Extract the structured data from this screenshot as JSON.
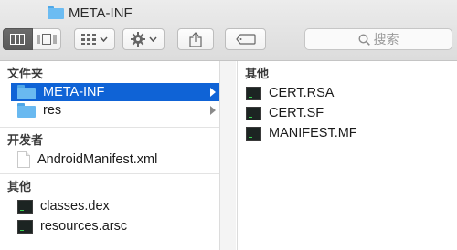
{
  "window": {
    "title": "META-INF"
  },
  "toolbar": {
    "view_icons": [
      "columns-view-icon",
      "coverflow-view-icon"
    ],
    "arrange_icon": "grid-arrange-icon",
    "action_icon": "gear-icon",
    "share_icon": "share-icon",
    "tag_icon": "tag-icon",
    "search_placeholder": "搜索"
  },
  "column1": {
    "header": "文件夹",
    "folders": [
      {
        "name": "META-INF",
        "selected": true,
        "has_children": true
      },
      {
        "name": "res",
        "selected": false,
        "has_children": true
      }
    ],
    "section2_header": "开发者",
    "dev_files": [
      {
        "name": "AndroidManifest.xml"
      }
    ],
    "section3_header": "其他",
    "other_files": [
      {
        "name": "classes.dex"
      },
      {
        "name": "resources.arsc"
      }
    ]
  },
  "column2": {
    "header": "其他",
    "files": [
      {
        "name": "CERT.RSA"
      },
      {
        "name": "CERT.SF"
      },
      {
        "name": "MANIFEST.MF"
      }
    ]
  },
  "colors": {
    "selection": "#0f63d6",
    "folder": "#69b9f0"
  }
}
